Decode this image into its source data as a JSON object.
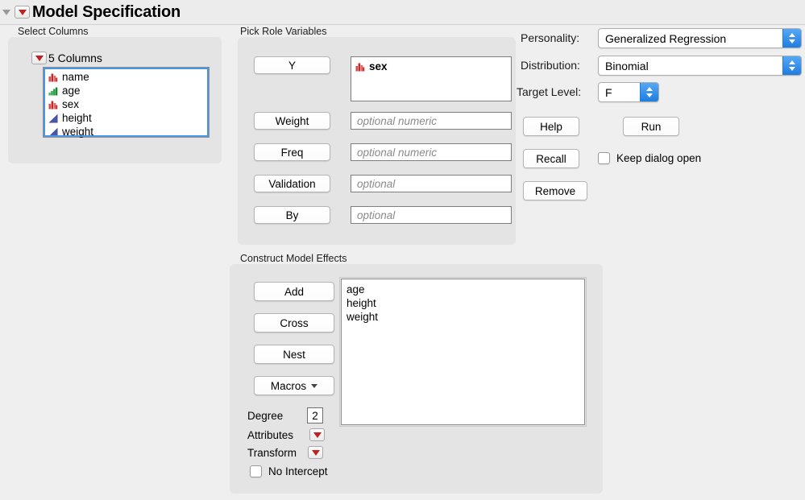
{
  "window": {
    "title": "Model Specification",
    "disclosure_icon": "red-triangle-menu-icon",
    "outer_disclosure_icon": "gray-triangle-icon"
  },
  "select_columns": {
    "group_label": "Select Columns",
    "columns_header": "5 Columns",
    "columns": [
      {
        "name": "name",
        "type": "nominal",
        "icon": "nominal-red-bars-icon"
      },
      {
        "name": "age",
        "type": "ordinal",
        "icon": "ordinal-green-bars-icon"
      },
      {
        "name": "sex",
        "type": "nominal",
        "icon": "nominal-red-bars-icon"
      },
      {
        "name": "height",
        "type": "continuous",
        "icon": "continuous-blue-triangle-icon"
      },
      {
        "name": "weight",
        "type": "continuous",
        "icon": "continuous-blue-triangle-icon"
      }
    ]
  },
  "pick_role_variables": {
    "group_label": "Pick Role Variables",
    "roles": [
      {
        "button": "Y",
        "value": "sex",
        "value_icon": "nominal-red-bars-icon",
        "placeholder": ""
      },
      {
        "button": "Weight",
        "value": "",
        "placeholder": "optional numeric"
      },
      {
        "button": "Freq",
        "value": "",
        "placeholder": "optional numeric"
      },
      {
        "button": "Validation",
        "value": "",
        "placeholder": "optional"
      },
      {
        "button": "By",
        "value": "",
        "placeholder": "optional"
      }
    ]
  },
  "construct_model_effects": {
    "group_label": "Construct Model Effects",
    "buttons": [
      {
        "label": "Add",
        "has_caret": false
      },
      {
        "label": "Cross",
        "has_caret": false
      },
      {
        "label": "Nest",
        "has_caret": false
      },
      {
        "label": "Macros",
        "has_caret": true
      }
    ],
    "effects": [
      "age",
      "height",
      "weight"
    ],
    "degree_label": "Degree",
    "degree_value": "2",
    "attributes_label": "Attributes",
    "transform_label": "Transform",
    "no_intercept_label": "No Intercept",
    "no_intercept_checked": false
  },
  "options": {
    "personality_label": "Personality:",
    "personality_value": "Generalized Regression",
    "distribution_label": "Distribution:",
    "distribution_value": "Binomial",
    "target_level_label": "Target Level:",
    "target_level_value": "F",
    "buttons": {
      "help": "Help",
      "run": "Run",
      "recall": "Recall",
      "remove": "Remove"
    },
    "keep_dialog_open_label": "Keep dialog open",
    "keep_dialog_open_checked": false
  },
  "colors": {
    "nominal": "#cf3333",
    "ordinal": "#1a9c3c",
    "continuous": "#38459a",
    "accent_blue": "#2f86e8",
    "panel_bg": "#e4e4e5",
    "window_bg": "#efeff0",
    "menu_red": "#c21f1f"
  }
}
